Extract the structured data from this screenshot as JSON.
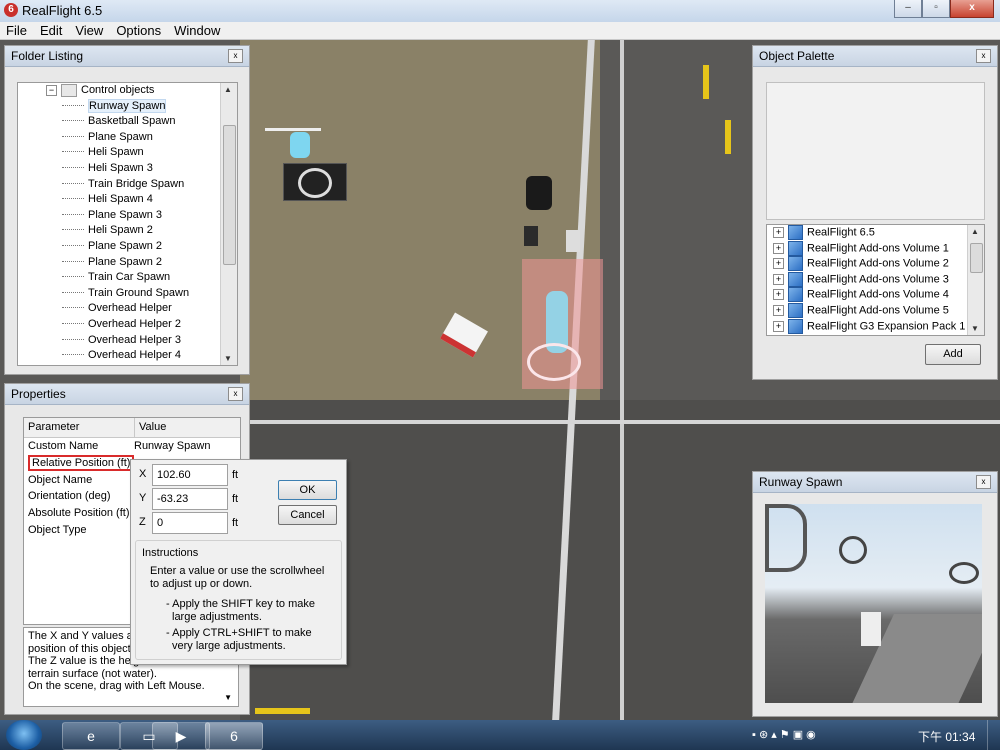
{
  "window": {
    "title": "RealFlight 6.5",
    "app_icon": "6",
    "min": "–",
    "max": "▫",
    "close": "x"
  },
  "menu": [
    "File",
    "Edit",
    "View",
    "Options",
    "Window"
  ],
  "folder_listing": {
    "title": "Folder Listing",
    "close": "x",
    "root": "Control objects",
    "items": [
      "Runway Spawn",
      "Basketball Spawn",
      "Plane Spawn",
      "Heli Spawn",
      "Heli Spawn 3",
      "Train Bridge Spawn",
      "Heli Spawn 4",
      "Plane Spawn 3",
      "Heli Spawn 2",
      "Plane Spawn 2",
      "Plane Spawn 2",
      "Train Car Spawn",
      "Train Ground Spawn",
      "Overhead Helper",
      "Overhead Helper 2",
      "Overhead Helper 3",
      "Overhead Helper 4"
    ]
  },
  "object_palette": {
    "title": "Object Palette",
    "close": "x",
    "items": [
      "RealFlight 6.5",
      "RealFlight Add-ons Volume 1",
      "RealFlight Add-ons Volume 2",
      "RealFlight Add-ons Volume 3",
      "RealFlight Add-ons Volume 4",
      "RealFlight Add-ons Volume 5",
      "RealFlight G3 Expansion Pack 1"
    ],
    "add_label": "Add"
  },
  "properties": {
    "title": "Properties",
    "close": "x",
    "col_parameter": "Parameter",
    "col_value": "Value",
    "rows": [
      {
        "param": "Custom Name",
        "value": "Runway Spawn"
      },
      {
        "param": "Relative Position (ft)",
        "value": ""
      },
      {
        "param": "Object Name",
        "value": ""
      },
      {
        "param": "Orientation (deg)",
        "value": ""
      },
      {
        "param": "Absolute Position (ft)",
        "value": ""
      },
      {
        "param": "Object Type",
        "value": ""
      }
    ],
    "help_lines": [
      "The X and Y values are",
      "position of this object f",
      "The Z value is the heig",
      "terrain surface (not water).",
      "On the scene, drag with Left Mouse."
    ]
  },
  "position_editor": {
    "x_label": "X",
    "x_value": "102.60",
    "y_label": "Y",
    "y_value": "-63.23",
    "z_label": "Z",
    "z_value": "0",
    "unit": "ft",
    "ok_label": "OK",
    "cancel_label": "Cancel",
    "instructions_title": "Instructions",
    "instructions_1": "Enter a value or use the scrollwheel",
    "instructions_2": "to adjust up or down.",
    "instructions_3": "- Apply the SHIFT key to make",
    "instructions_4": "large adjustments.",
    "instructions_5": "- Apply CTRL+SHIFT to make",
    "instructions_6": "very large adjustments."
  },
  "preview": {
    "title": "Runway Spawn",
    "close": "x"
  },
  "taskbar": {
    "clock": "下午 01:34"
  },
  "colors": {
    "highlight_box": "#d92b2b",
    "selection": "#e5f0fb"
  }
}
